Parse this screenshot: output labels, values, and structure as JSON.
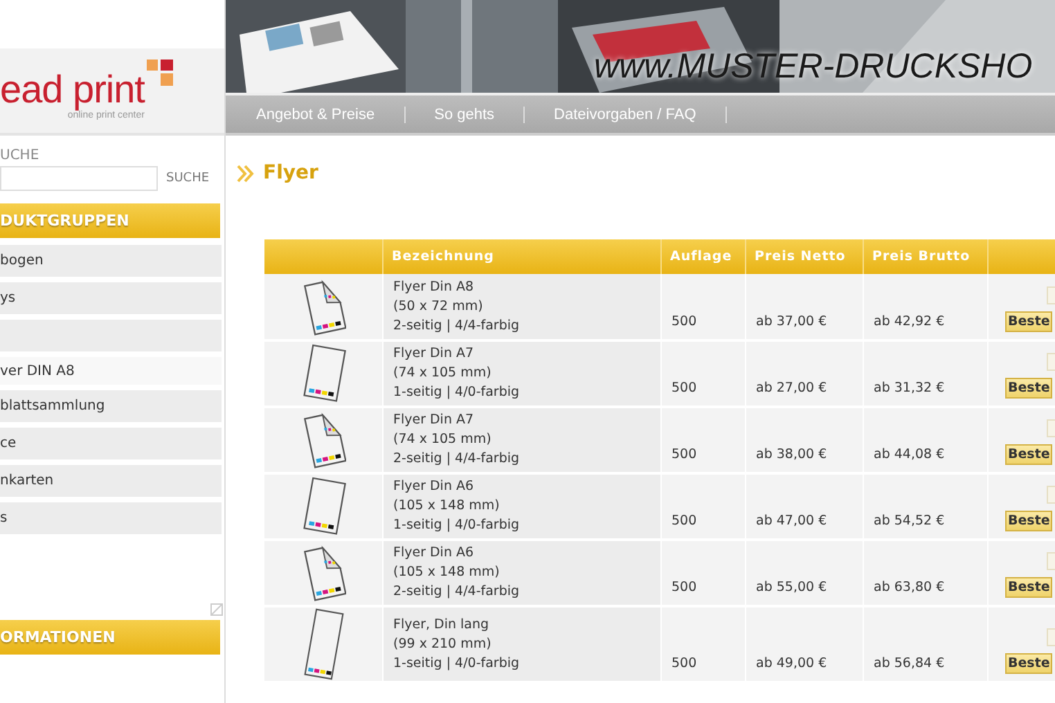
{
  "logo": {
    "name": "ead print",
    "tagline": "online print center"
  },
  "banner": {
    "site_name": "www.MUSTER-DRUCKSHO"
  },
  "nav": [
    "Angebot & Preise",
    "So gehts",
    "Dateivorgaben / FAQ"
  ],
  "search": {
    "label": "UCHE",
    "button": "SUCHE"
  },
  "product_groups": {
    "title": "DUKTGRUPPEN",
    "items": [
      {
        "label": "bogen",
        "selected": false
      },
      {
        "label": "ys",
        "selected": false
      },
      {
        "selected": false
      },
      {
        "label": "ver DIN A8",
        "selected": true
      },
      {
        "label": "blattsammlung",
        "selected": false
      },
      {
        "label": "ce",
        "selected": false
      },
      {
        "label": "nkarten",
        "selected": false
      },
      {
        "label": "s",
        "selected": false
      }
    ]
  },
  "info": {
    "title": "ORMATIONEN"
  },
  "page_title": "Flyer",
  "table": {
    "columns": [
      "",
      "Bezeichnung",
      "Auflage",
      "Preis Netto",
      "Preis Brutto",
      ""
    ],
    "rows": [
      {
        "kind": "double",
        "lines": [
          "Flyer Din A8",
          "(50 x 72 mm)",
          "2-seitig | 4/4-farbig"
        ],
        "auflage": "500",
        "netto": "ab 37,00 €",
        "brutto": "ab 42,92 €",
        "order": "Beste"
      },
      {
        "kind": "single",
        "lines": [
          "Flyer Din A7",
          "(74 x 105 mm)",
          "1-seitig | 4/0-farbig"
        ],
        "auflage": "500",
        "netto": "ab 27,00 €",
        "brutto": "ab 31,32 €",
        "order": "Beste"
      },
      {
        "kind": "double",
        "lines": [
          "Flyer Din A7",
          "(74 x 105 mm)",
          "2-seitig | 4/4-farbig"
        ],
        "auflage": "500",
        "netto": "ab 38,00 €",
        "brutto": "ab 44,08 €",
        "order": "Beste"
      },
      {
        "kind": "single",
        "lines": [
          "Flyer Din A6",
          "(105 x 148 mm)",
          "1-seitig | 4/0-farbig"
        ],
        "auflage": "500",
        "netto": "ab 47,00 €",
        "brutto": "ab 54,52 €",
        "order": "Beste"
      },
      {
        "kind": "double",
        "lines": [
          "Flyer Din A6",
          "(105 x 148 mm)",
          "2-seitig | 4/4-farbig"
        ],
        "auflage": "500",
        "netto": "ab 55,00 €",
        "brutto": "ab 63,80 €",
        "order": "Beste"
      },
      {
        "kind": "long",
        "lines": [
          "Flyer, Din lang",
          "(99 x 210 mm)",
          "1-seitig | 4/0-farbig"
        ],
        "auflage": "500",
        "netto": "ab 49,00 €",
        "brutto": "ab 56,84 €",
        "order": "Beste"
      }
    ]
  }
}
